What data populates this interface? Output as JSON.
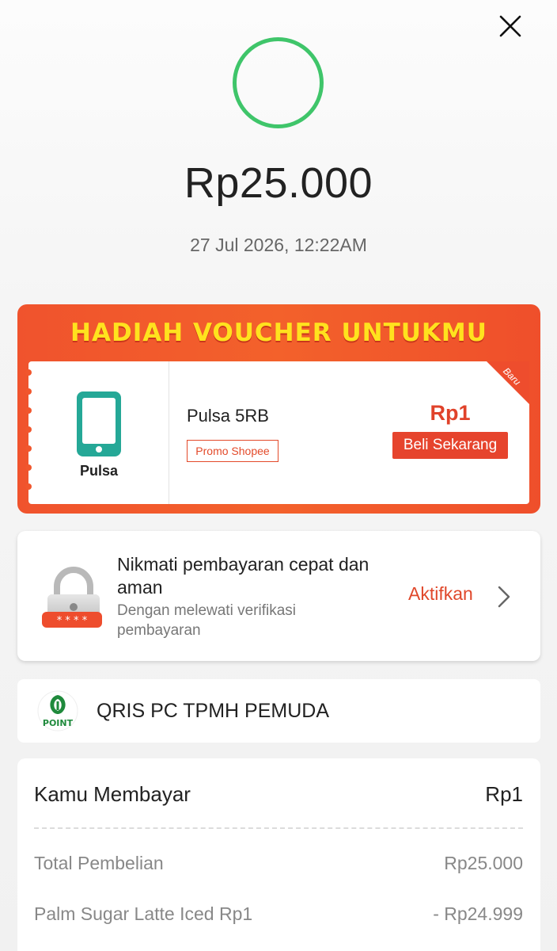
{
  "header": {
    "close_icon": "close-icon"
  },
  "status": {
    "ring_color": "#3fc56a"
  },
  "transaction": {
    "amount": "Rp25.000",
    "datetime": "27 Jul 2026, 12:22AM"
  },
  "voucher": {
    "title": "HADIAH VOUCHER UNTUKMU",
    "category_label": "Pulsa",
    "category_icon": "phone-icon",
    "name": "Pulsa 5RB",
    "tag": "Promo Shopee",
    "price": "Rp1",
    "buy_label": "Beli Sekarang",
    "ribbon_label": "Baru",
    "accent_color": "#ee4d2d",
    "title_color": "#ffe21e"
  },
  "secure_payment": {
    "icon": "lock-icon",
    "title": "Nikmati pembayaran cepat dan aman",
    "subtitle": "Dengan melewati verifikasi pembayaran",
    "action_label": "Aktifkan",
    "action_icon": "chevron-right-icon"
  },
  "merchant": {
    "logo": "merchant-logo",
    "name": "QRIS PC TPMH PEMUDA"
  },
  "payment_detail": {
    "paid_label": "Kamu Membayar",
    "paid_value": "Rp1",
    "rows": [
      {
        "label": "Total Pembelian",
        "value": "Rp25.000"
      },
      {
        "label": "Palm Sugar Latte Iced Rp1",
        "value": "- Rp24.999"
      }
    ]
  }
}
